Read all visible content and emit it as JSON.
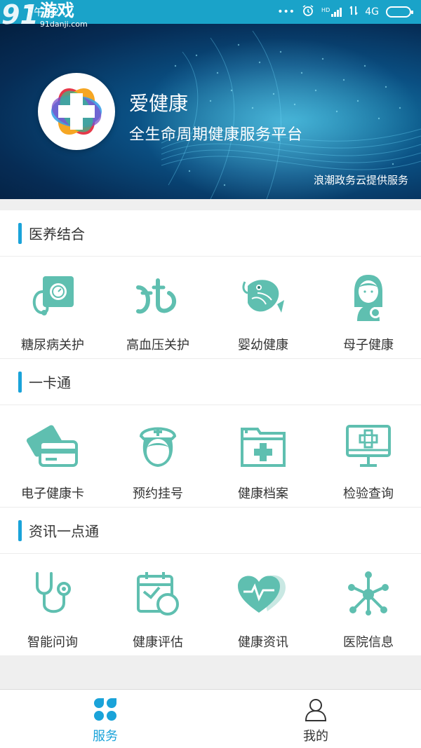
{
  "status_bar": {
    "time": "下午3:2",
    "network": "4G",
    "hd_label": "HD",
    "watermark_number": "91",
    "watermark_name": "游戏",
    "watermark_url": "91danji.com"
  },
  "banner": {
    "app_name": "爱健康",
    "subtitle": "全生命周期健康服务平台",
    "provider": "浪潮政务云提供服务"
  },
  "sections": [
    {
      "title": "医养结合",
      "items": [
        {
          "label": "糖尿病关护",
          "icon": "blood-pressure-monitor-icon"
        },
        {
          "label": "高血压关护",
          "icon": "pulse-symbol-icon"
        },
        {
          "label": "婴幼健康",
          "icon": "koi-fish-icon"
        },
        {
          "label": "母子健康",
          "icon": "mother-child-icon"
        }
      ]
    },
    {
      "title": "一卡通",
      "items": [
        {
          "label": "电子健康卡",
          "icon": "health-card-icon"
        },
        {
          "label": "预约挂号",
          "icon": "nurse-icon"
        },
        {
          "label": "健康档案",
          "icon": "medical-folder-icon"
        },
        {
          "label": "检验查询",
          "icon": "monitor-cross-icon"
        }
      ]
    },
    {
      "title": "资讯一点通",
      "items": [
        {
          "label": "智能问询",
          "icon": "stethoscope-icon"
        },
        {
          "label": "健康评估",
          "icon": "calendar-assessment-icon"
        },
        {
          "label": "健康资讯",
          "icon": "heart-pulse-icon"
        },
        {
          "label": "医院信息",
          "icon": "network-molecule-icon"
        }
      ]
    }
  ],
  "bottom_nav": {
    "items": [
      {
        "label": "服务",
        "icon": "clover-grid-icon",
        "active": true
      },
      {
        "label": "我的",
        "icon": "user-profile-icon",
        "active": false
      }
    ]
  },
  "colors": {
    "accent": "#1aa3d9",
    "icon_teal": "#5fbfb0",
    "status_bar": "#1aa3c9"
  }
}
